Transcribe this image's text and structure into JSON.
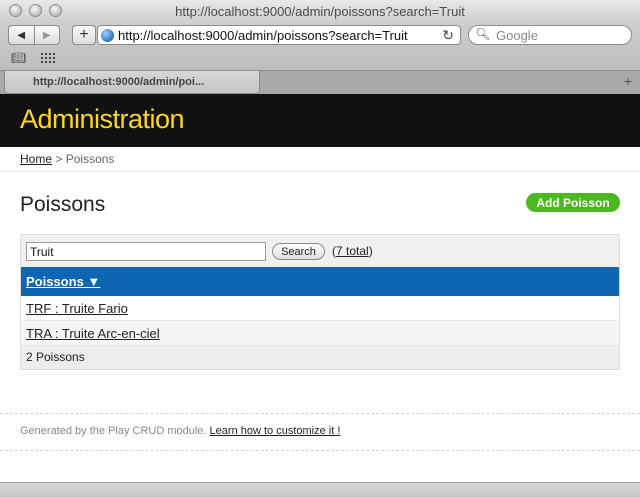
{
  "browser": {
    "window_title": "http://localhost:9000/admin/poissons?search=Truit",
    "address": "http://localhost:9000/admin/poissons?search=Truit",
    "search_placeholder": "Google",
    "tab_label": "http://localhost:9000/admin/poi..."
  },
  "page": {
    "header_title": "Administration",
    "breadcrumb": {
      "home": "Home",
      "separator": ">",
      "current": "Poissons"
    },
    "title": "Poissons",
    "add_button": "Add Poisson",
    "search": {
      "value": "Truit",
      "button": "Search",
      "total_open": "(",
      "total_link": "7 total",
      "total_close": ")"
    },
    "list_header": "Poissons ▼",
    "rows": [
      "TRF : Truite Fario",
      "TRA : Truite Arc-en-ciel"
    ],
    "count": "2 Poissons",
    "footer": {
      "text": "Generated by the Play CRUD module.",
      "link": "Learn how to customize it !"
    }
  },
  "colors": {
    "header_bg": "#111111",
    "header_title": "#ffd71f",
    "accent_green": "#4cb81f",
    "list_header_blue": "#0e66b3"
  }
}
